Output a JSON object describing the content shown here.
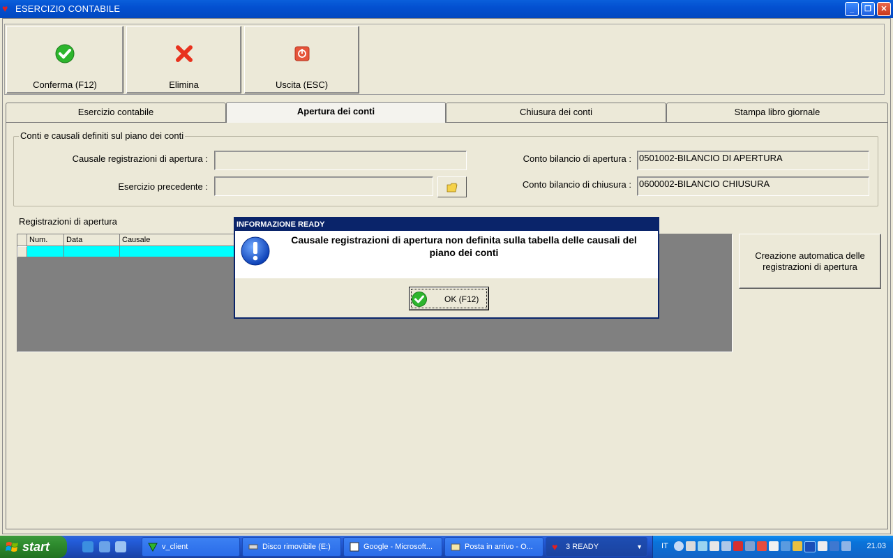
{
  "window": {
    "title": "ESERCIZIO CONTABILE"
  },
  "toolbar": {
    "conferma_label": "Conferma (F12)",
    "elimina_label": "Elimina",
    "uscita_label": "Uscita (ESC)"
  },
  "tabs": [
    {
      "label": "Esercizio contabile"
    },
    {
      "label": "Apertura dei conti"
    },
    {
      "label": "Chiusura dei conti"
    },
    {
      "label": "Stampa libro giornale"
    }
  ],
  "active_tab": "Apertura dei conti",
  "group": {
    "title": "Conti e causali definiti sul piano dei conti",
    "causale_label": "Causale registrazioni di apertura :",
    "causale_value": "",
    "esercizio_prec_label": "Esercizio precedente :",
    "esercizio_prec_value": "",
    "conto_apertura_label": "Conto bilancio di apertura :",
    "conto_apertura_value": "0501002-BILANCIO DI APERTURA",
    "conto_chiusura_label": "Conto bilancio di chiusura :",
    "conto_chiusura_value": "0600002-BILANCIO CHIUSURA"
  },
  "registrazioni": {
    "label": "Registrazioni di apertura",
    "columns": [
      "Num.",
      "Data",
      "Causale"
    ],
    "creazione_button": "Creazione automatica delle registrazioni di apertura"
  },
  "dialog": {
    "title": "INFORMAZIONE READY",
    "message": "Causale registrazioni di apertura non definita sulla tabella delle causali del piano dei conti",
    "ok_label": "OK (F12)"
  },
  "taskbar": {
    "start_label": "start",
    "tasks": [
      {
        "label": "v_client"
      },
      {
        "label": "Disco rimovibile (E:)"
      },
      {
        "label": "Google - Microsoft..."
      },
      {
        "label": "Posta in arrivo - O..."
      },
      {
        "label": "3 READY"
      }
    ],
    "language": "IT",
    "clock": "21.03"
  },
  "colors": {
    "titlebar": "#0350D0",
    "dialog_titlebar": "#0A246A",
    "grid_row": "#00FFFF",
    "window_bg": "#ECE9D8"
  }
}
